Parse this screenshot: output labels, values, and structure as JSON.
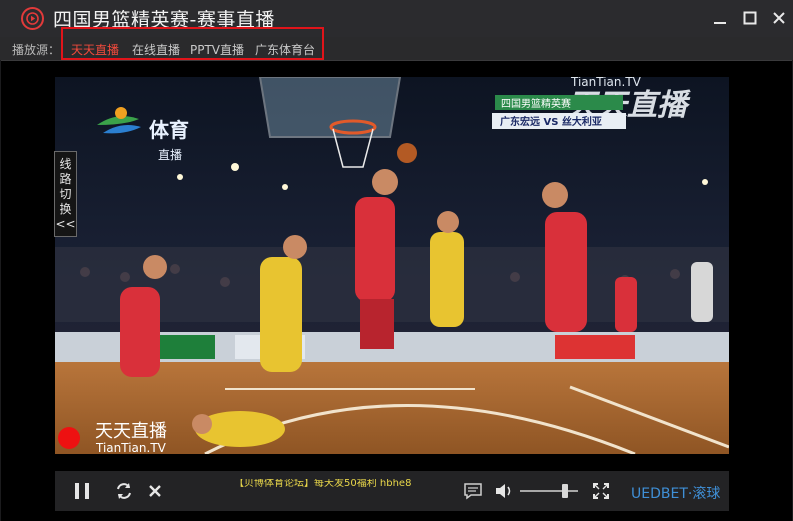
{
  "window": {
    "title": "四国男篮精英赛-赛事直播"
  },
  "source_bar": {
    "label": "播放源：",
    "sources": [
      {
        "label": "天天直播",
        "active": true
      },
      {
        "label": "在线直播",
        "active": false
      },
      {
        "label": "PPTV直播",
        "active": false
      },
      {
        "label": "广东体育台",
        "active": false
      }
    ]
  },
  "player": {
    "line_switch": [
      "线",
      "路",
      "切",
      "换",
      "<<"
    ],
    "video": {
      "channel_logo_text": "体育",
      "channel_logo_sub": "直播",
      "brand_watermark_en": "TianTian.TV",
      "brand_watermark_cn": "天天直播",
      "score_header": "四国男篮精英赛",
      "score_line": "广东宏远 VS 丝大利亚",
      "bottom_logo_cn": "天天直播",
      "bottom_logo_en": "TianTian.TV"
    },
    "controls": {
      "ticker_text": "【贝博体育论坛】每天发50福利 hbhe8",
      "sponsor": "UEDBET·滚球",
      "volume_level": 0.8
    }
  },
  "colors": {
    "accent_red": "#e0141a",
    "active_source": "#f14a3c",
    "sponsor_blue": "#3f8fd6",
    "ticker_yellow": "#e9d74a"
  },
  "icons": {
    "app": "play-circle-icon",
    "minimize": "minimize-icon",
    "maximize": "maximize-icon",
    "close": "close-icon",
    "pause": "pause-icon",
    "refresh": "refresh-icon",
    "stop": "stop-icon",
    "danmaku": "chat-bubble-icon",
    "volume": "volume-icon",
    "fullscreen": "fullscreen-icon"
  }
}
